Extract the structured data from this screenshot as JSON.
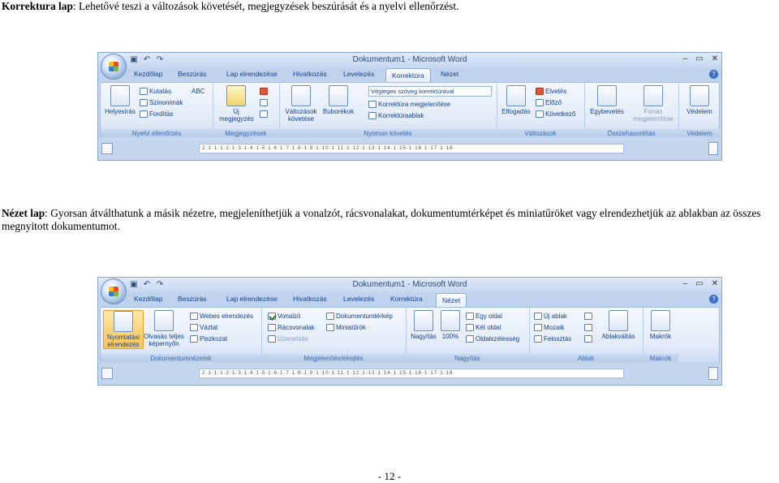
{
  "para1": {
    "heading": "Korrektura lap",
    "text": ": Lehetővé teszi a változások követését, megjegyzések beszúrását és a nyelvi ellenőrzést."
  },
  "para2": {
    "heading": "Nézet lap",
    "text": ": Gyorsan átválthatunk a másik nézetre, megjeleníthetjük a vonalzót, rácsvonalakat, dokumentumtérképet és miniatűröket vagy elrendezhetjük az ablakban az összes megnyitott dokumentumot."
  },
  "footer": "- 12 -",
  "window": {
    "title": "Dokumentum1 - Microsoft Word",
    "controls": [
      "–",
      "▭",
      "✕"
    ]
  },
  "tabs": [
    "Kezdőlap",
    "Beszúrás",
    "Lap elrendezése",
    "Hivatkozás",
    "Levelezés",
    "Korrektúra",
    "Nézet"
  ],
  "ruler": "·2·1·1·1·2·1·3·1·4·1·5·1·6·1·7·1·8·1·9·1·10·1·11·1·12·1·13·1·14·1·15·1·16·1·17·1·18·",
  "shot1": {
    "active_tab": "Korrektúra",
    "groups": {
      "nyelvi": {
        "label": "Nyelvi ellenőrzés",
        "big": "Helyesírás",
        "items": [
          "Kutatás",
          "Szinonimák",
          "Fordítás"
        ],
        "small": [
          "ABC"
        ]
      },
      "megjegyzesek": {
        "label": "Megjegyzések",
        "big": "Új megjegyzés"
      },
      "nyomon": {
        "label": "Nyomon követés",
        "big1": "Változások követése",
        "big2": "Buborékok",
        "combo": "Végleges szöveg korrektúrával",
        "items": [
          "Korrektúra megjelenítése",
          "Korrektúraablak"
        ]
      },
      "valtozasok": {
        "label": "Változások",
        "big": "Elfogadás",
        "items": [
          "Elvetés",
          "Előző",
          "Következő"
        ]
      },
      "osszehasonlitas": {
        "label": "Összehasonlítás",
        "big1": "Egybevetés",
        "big2": "Forrás megjelenítése"
      },
      "vedelem": {
        "label": "Védelem",
        "big": "Védelem"
      }
    }
  },
  "shot2": {
    "active_tab": "Nézet",
    "groups": {
      "dokumentumnezetek": {
        "label": "Dokumentumnézetek",
        "big1": "Nyomtatási elrendezés",
        "big2": "Olvasás teljes képernyőn",
        "items": [
          "Webes elrendezés",
          "Vázlat",
          "Piszkozat"
        ]
      },
      "megjelenites": {
        "label": "Megjelenítés/elrejtés",
        "items": [
          "Vonalzó",
          "Rácsvonalak",
          "Üzenetsáv",
          "Dokumentumtérkép",
          "Miniatűrök"
        ]
      },
      "nagyitas": {
        "label": "Nagyítás",
        "big1": "Nagyítás",
        "big2": "100%",
        "items": [
          "Egy oldal",
          "Két oldal",
          "Oldalszélesség"
        ]
      },
      "ablak": {
        "label": "Ablak",
        "items": [
          "Új ablak",
          "Mozaik",
          "Felosztás"
        ],
        "big": "Ablakváltás"
      },
      "makrok": {
        "label": "Makrók",
        "big": "Makrók"
      }
    }
  }
}
